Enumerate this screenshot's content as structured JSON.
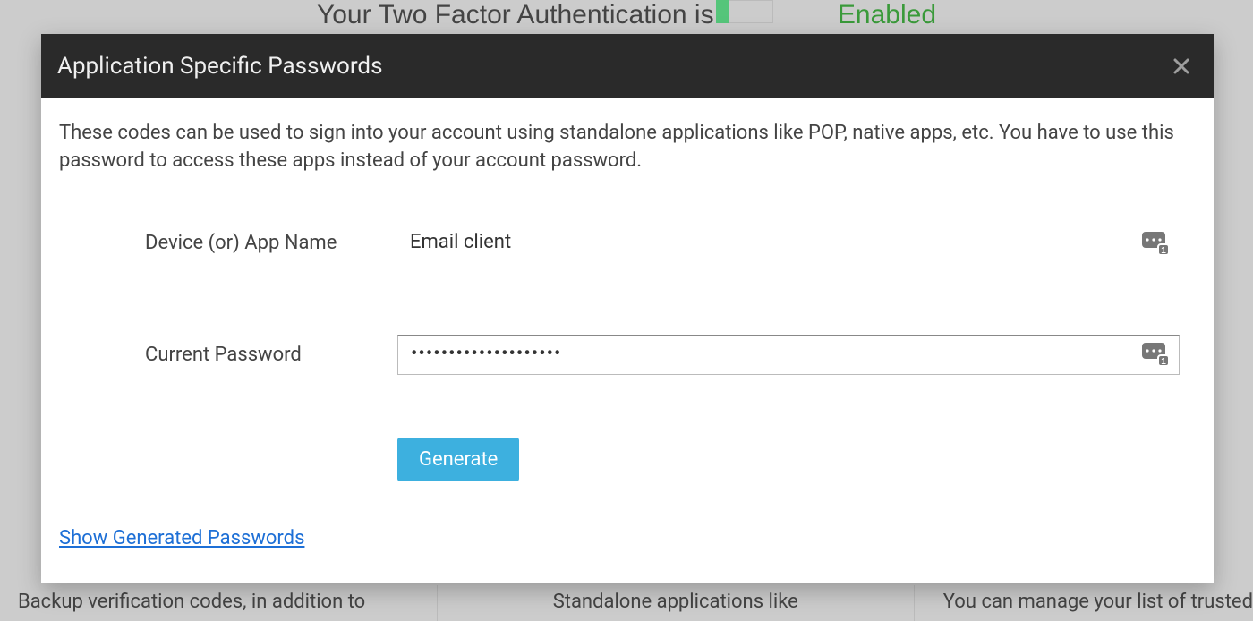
{
  "background": {
    "heading_prefix": "Your Two Factor Authentication is",
    "status": "Enabled",
    "columns": {
      "c1": "Backup verification codes, in addition to",
      "c2": "Standalone applications like",
      "c3": "You can manage your list of trusted"
    }
  },
  "modal": {
    "title": "Application Specific Passwords",
    "close_label": "Close",
    "description": "These codes can be used to sign into your account using standalone applications like POP, native apps, etc. You have to use this password to access these apps instead of your account password.",
    "fields": {
      "device": {
        "label": "Device (or) App Name",
        "value": "Email client"
      },
      "password": {
        "label": "Current Password",
        "value": "••••••••••••••••••••"
      }
    },
    "generate_label": "Generate",
    "show_link": "Show Generated Passwords"
  }
}
